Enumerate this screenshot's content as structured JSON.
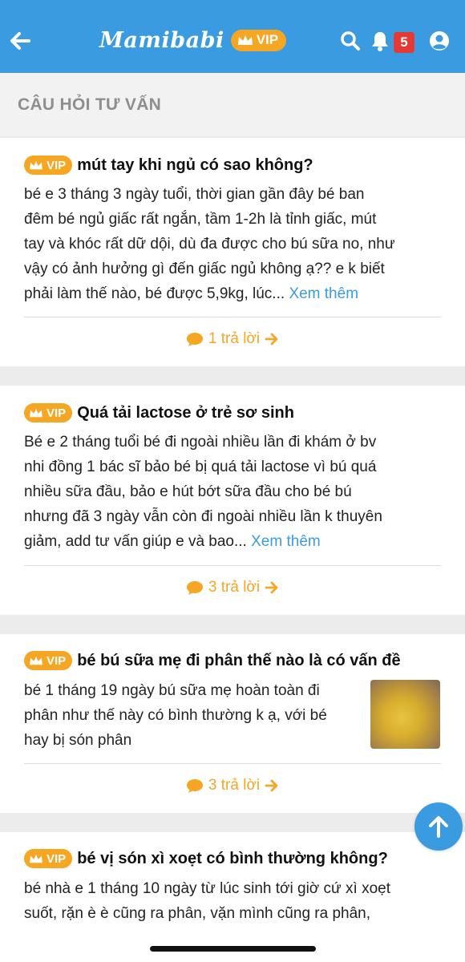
{
  "header": {
    "logo": "Mamibabi",
    "vip_label": "VIP",
    "notification_count": "5"
  },
  "section": {
    "title": "CÂU HỎI TƯ VẤN"
  },
  "vip_badge": "VIP",
  "more_label": "Xem thêm",
  "questions": [
    {
      "title": "mút tay khi ngủ có sao không?",
      "lines": [
        "bé e 3 tháng 3 ngày tuổi, thời gian gần đây bé ban",
        "đêm bé ngủ giấc rất ngắn, tầm 1-2h là tỉnh giấc, mút",
        "tay và khóc rất dữ dội, dù đa được cho bú sữa no, như",
        "vậy có ảnh hưởng gì đến giấc ngủ không ạ?? e k biết",
        "phải làm thế nào, bé được 5,9kg, lúc..."
      ],
      "reply": "1 trả lời"
    },
    {
      "title": "Quá tải lactose ở trẻ sơ sinh",
      "lines": [
        "Bé e 2 tháng tuổi bé đi ngoài nhiều lần đi khám ở bv",
        "nhi đồng 1 bác sĩ bảo bé bị quá tải lactose vì bú quá",
        "nhiều sữa đầu, bảo e hút bớt sữa đầu cho bé bú",
        "nhưng đã 3 ngày vẫn còn đi ngoài nhiều lần k thuyên",
        "giảm, add tư vấn giúp e và bao..."
      ],
      "reply": "3 trả lời"
    },
    {
      "title": "bé bú sữa mẹ đi phân thế nào là có vấn đề",
      "lines": [
        "bé 1 tháng 19 ngày bú sữa mẹ hoàn toàn đi",
        "phân như thế này có bình thường k ạ, với bé",
        "hay bị són phân"
      ],
      "reply": "3 trả lời"
    },
    {
      "title": "bé vị són xì xoẹt có bình thường không?",
      "lines": [
        "bé nhà e 1 tháng 10 ngày từ lúc sinh tới giờ cứ xì xoẹt",
        "suốt, rặn è è cũng ra phân, vặn mình cũng ra phân,"
      ]
    }
  ]
}
